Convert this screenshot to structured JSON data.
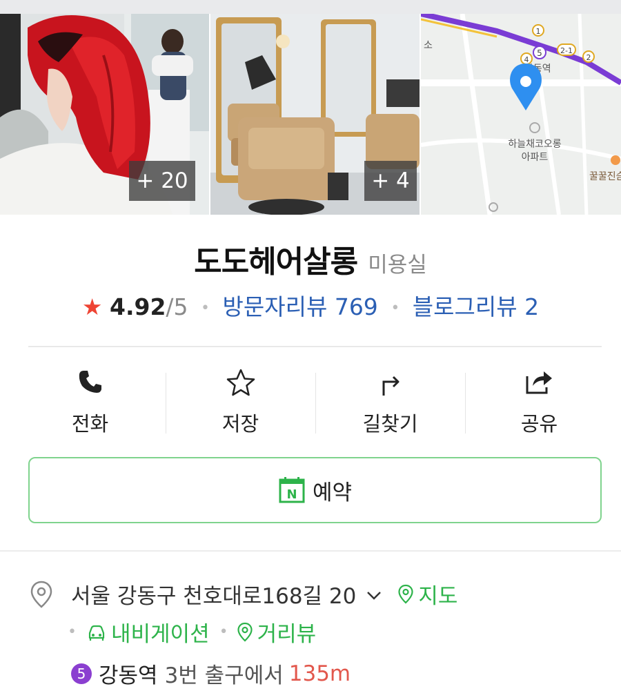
{
  "photos": {
    "photo1_more": "+ 20",
    "photo2_more": "+ 4",
    "map_labels": {
      "station": "강동역",
      "building": "하늘채코오롱\n아파트",
      "building_line1": "하늘채코오롱",
      "building_line2": "아파트",
      "shop": "꿀꿀진슴",
      "left_text": "소",
      "exit_numbers": [
        "1",
        "2",
        "4",
        "5",
        "2-1"
      ]
    }
  },
  "place": {
    "name": "도도헤어살롱",
    "category": "미용실"
  },
  "rating": {
    "value": "4.92",
    "max": "/5",
    "visitor_reviews": "방문자리뷰 769",
    "blog_reviews": "블로그리뷰 2"
  },
  "actions": [
    {
      "label": "전화",
      "icon": "phone-icon"
    },
    {
      "label": "저장",
      "icon": "star-outline-icon"
    },
    {
      "label": "길찾기",
      "icon": "directions-icon"
    },
    {
      "label": "공유",
      "icon": "share-icon"
    }
  ],
  "reserve": {
    "label": "예약",
    "icon_letter": "N"
  },
  "address": {
    "text": "서울 강동구 천호대로168길 20",
    "map_link": "지도",
    "navigation_link": "내비게이션",
    "street_view_link": "거리뷰"
  },
  "subway": {
    "line": "5",
    "station": "강동역",
    "exit_text": "3번 출구에서",
    "distance": "135m"
  },
  "colors": {
    "star": "#ee4434",
    "link_blue": "#2b5fb4",
    "green": "#2db34a",
    "line5_purple": "#8b3fd0",
    "distance_red": "#e2574c",
    "map_pin": "#2e8ff0"
  }
}
